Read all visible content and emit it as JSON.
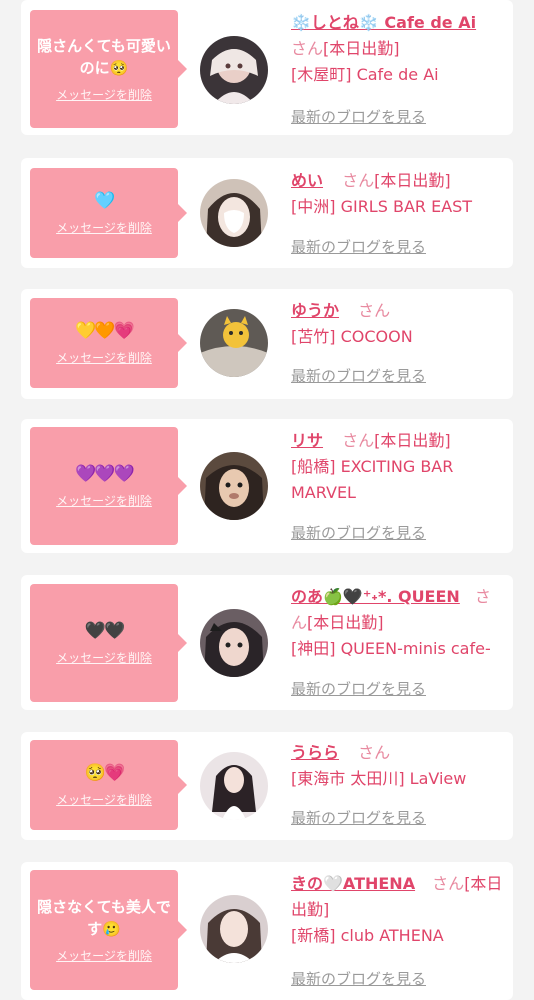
{
  "delete_label": "メッセージを削除",
  "blog_label": "最新のブログを見る",
  "colors": {
    "bubble": "#f99eaa",
    "accent": "#e0456a",
    "link_gray": "#9a9a9a"
  },
  "entries": [
    {
      "message": "隠さんくても可愛いのに🥺",
      "name": "❄️しとね❄️ Cafe de Ai",
      "suffix": "さん",
      "status": "[本日出勤]",
      "shop": "[木屋町] Cafe de Ai"
    },
    {
      "message": "🩵",
      "name": "めい",
      "suffix": "さん",
      "status": "[本日出勤]",
      "shop": "[中洲] GIRLS BAR EAST"
    },
    {
      "message": "💛🧡💗",
      "name": "ゆうか",
      "suffix": "さん",
      "status": "",
      "shop": "[苫竹] COCOON"
    },
    {
      "message": "💜💜💜",
      "name": "リサ",
      "suffix": "さん",
      "status": "[本日出勤]",
      "shop": "[船橋] EXCITING BAR MARVEL"
    },
    {
      "message": "🖤🖤",
      "name": "のあ🍏🖤⁺˖*. QUEEN",
      "suffix": "さん",
      "status": "[本日出勤]",
      "shop": "[神田] QUEEN-minis cafe-"
    },
    {
      "message": "🥺💗",
      "name": "うらら",
      "suffix": "さん",
      "status": "",
      "shop": "[東海市 太田川] LaView"
    },
    {
      "message": "隠さなくても美人です🥲",
      "name": "きの🤍ATHENA",
      "suffix": "さん",
      "status": "[本日出勤]",
      "shop": "[新橋] club ATHENA"
    }
  ]
}
